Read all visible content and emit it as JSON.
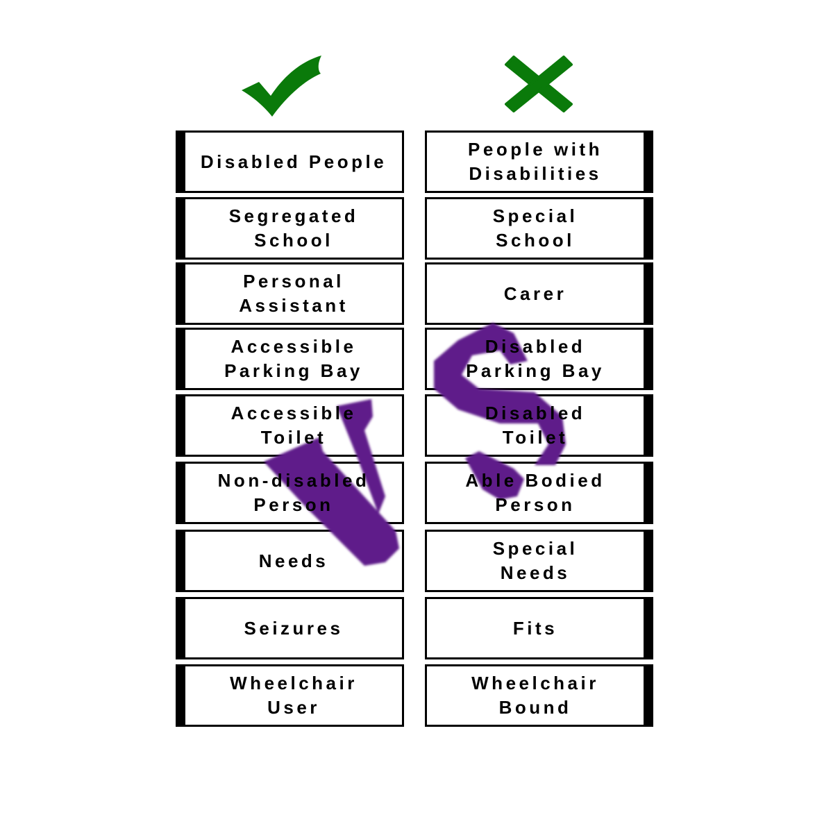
{
  "headers": {
    "left_icon": "check-mark-icon",
    "right_icon": "x-mark-icon",
    "icon_color": "#0a7a0a"
  },
  "overlay": {
    "text": "VS",
    "color": "#5e1a8a"
  },
  "left_terms": [
    "Disabled People",
    "Segregated\nSchool",
    "Personal\nAssistant",
    "Accessible\nParking Bay",
    "Accessible\nToilet",
    "Non-disabled\nPerson",
    "Needs",
    "Seizures",
    "Wheelchair\nUser"
  ],
  "right_terms": [
    "People with\nDisabilities",
    "Special\nSchool",
    "Carer",
    "Disabled\nParking Bay",
    "Disabled\nToilet",
    "Able Bodied\nPerson",
    "Special\nNeeds",
    "Fits",
    "Wheelchair\nBound"
  ]
}
